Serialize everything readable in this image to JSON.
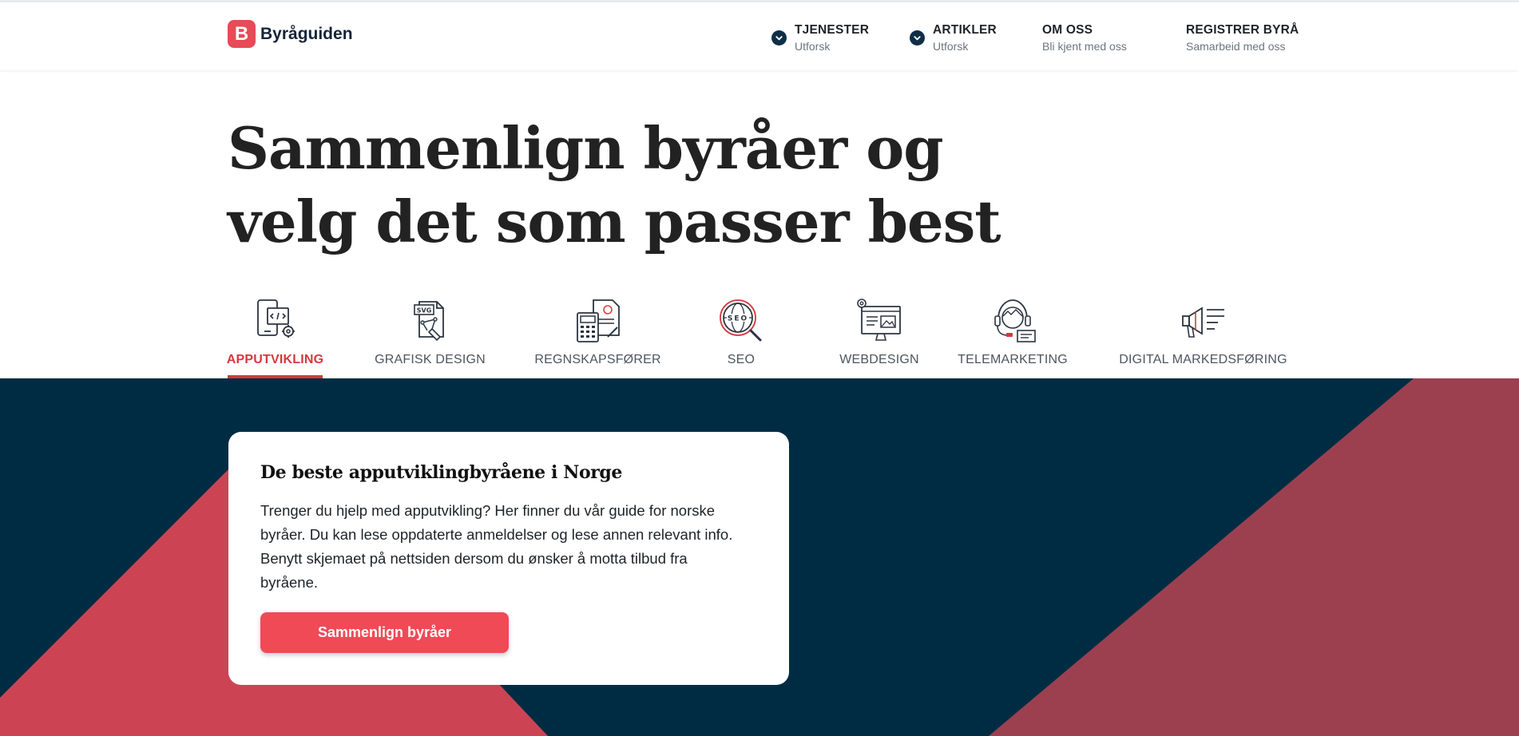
{
  "brand": {
    "logo_letter": "B",
    "name": "Byråguiden",
    "accent": "#e84a57"
  },
  "nav": [
    {
      "title": "TJENESTER",
      "sub": "Utforsk",
      "has_chevron": true
    },
    {
      "title": "ARTIKLER",
      "sub": "Utforsk",
      "has_chevron": true
    },
    {
      "title": "OM OSS",
      "sub": "Bli kjent med oss",
      "has_chevron": false
    },
    {
      "title": "REGISTRER BYRÅ",
      "sub": "Samarbeid med oss",
      "has_chevron": false
    }
  ],
  "hero": {
    "line1": "Sammenlign byråer og",
    "line2": "velg det som passer best"
  },
  "categories": [
    {
      "label": "APPUTVIKLING",
      "icon": "app-development-icon",
      "active": true
    },
    {
      "label": "GRAFISK DESIGN",
      "icon": "graphic-design-icon",
      "active": false
    },
    {
      "label": "REGNSKAPSFØRER",
      "icon": "accounting-icon",
      "active": false
    },
    {
      "label": "SEO",
      "icon": "seo-icon",
      "active": false
    },
    {
      "label": "WEBDESIGN",
      "icon": "webdesign-icon",
      "active": false
    },
    {
      "label": "TELEMARKETING",
      "icon": "telemarketing-icon",
      "active": false
    },
    {
      "label": "DIGITAL MARKEDSFØRING",
      "icon": "digital-marketing-icon",
      "active": false
    }
  ],
  "card": {
    "title": "De beste apputviklingbyråene i Norge",
    "body": "Trenger du hjelp med apputvikling? Her finner du vår guide for norske byråer. Du kan lese oppdaterte anmeldelser og lese annen relevant info. Benytt skjemaet på nettsiden dersom du ønsker å motta tilbud fra byråene.",
    "button": "Sammenlign byråer"
  },
  "colors": {
    "navy": "#002c43",
    "red": "#cc4454",
    "wine": "#9c4050",
    "button": "#f04a57"
  }
}
